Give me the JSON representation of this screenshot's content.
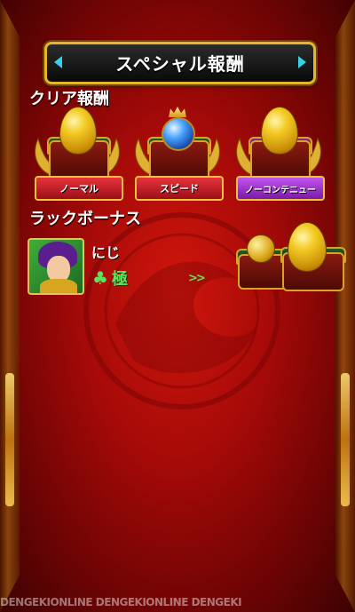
{
  "title": "スペシャル報酬",
  "clear_section": {
    "label": "クリア報酬",
    "rewards": [
      {
        "ribbon": "ノーマル",
        "color": "#c8202b",
        "item": "gold-egg"
      },
      {
        "ribbon": "スピード",
        "color": "#c8202b",
        "item": "blue-orb"
      },
      {
        "ribbon": "ノーコンテニュー",
        "color": "#9a2fd0",
        "item": "gold-egg"
      }
    ]
  },
  "luck_section": {
    "label": "ラックボーナス",
    "character_name": "にじ",
    "rank_icon": "clover-icon",
    "rank_text": "極",
    "arrows": ">>",
    "reward_items": [
      "gold-coin",
      "gold-egg"
    ]
  },
  "watermark": "DENGEKIONLINE DENGEKIONLINE DENGEKI",
  "colors": {
    "accent_gold": "#e7b42a",
    "luck_green": "#5fe25a",
    "background_red": "#b10d09"
  }
}
